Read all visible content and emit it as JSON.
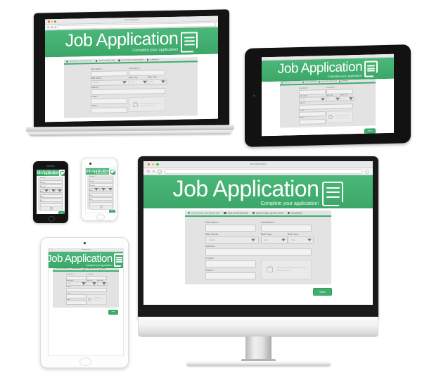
{
  "app": {
    "browser": {
      "window_title": "Job Application",
      "url_placeholder": "",
      "dot_colors": [
        "#ff5f57",
        "#febb2e",
        "#28c840"
      ]
    },
    "header": {
      "title": "Job Application",
      "subtitle": "Complete your application!",
      "icon": "document-form-icon",
      "background_color": "#3fae6e"
    },
    "tabs": [
      {
        "label": "PERSONAL INFORMATION",
        "active": true
      },
      {
        "label": "JOB INFORMATION",
        "active": false
      },
      {
        "label": "ADDITIONAL QUESTIONS",
        "active": false
      },
      {
        "label": "SUMMARY",
        "active": false
      }
    ],
    "form": {
      "fields": [
        {
          "label": "First Name *",
          "value": "",
          "type": "text"
        },
        {
          "label": "Last Name *",
          "value": "",
          "type": "text"
        },
        {
          "label": "Birth Month",
          "value": "",
          "placeholder": "Month",
          "type": "select"
        },
        {
          "label": "Birth Day",
          "value": "",
          "placeholder": "Day",
          "type": "select"
        },
        {
          "label": "Birth Year",
          "value": "",
          "placeholder": "Year",
          "type": "select"
        },
        {
          "label": "Address",
          "value": "",
          "type": "text"
        },
        {
          "label": "E-mail *",
          "value": "",
          "type": "text"
        },
        {
          "label": "Phone *",
          "value": "",
          "type": "text"
        }
      ],
      "privacy_note": "Your personal information is kept safe and secure",
      "privacy_icon": "lock-icon",
      "next_button": "Next"
    },
    "footer_note": ""
  },
  "devices": [
    {
      "name": "laptop",
      "chassis": "black-silver"
    },
    {
      "name": "tablet-landscape",
      "chassis": "black"
    },
    {
      "name": "tablet-portrait",
      "chassis": "white"
    },
    {
      "name": "phone-black",
      "chassis": "black"
    },
    {
      "name": "phone-white",
      "chassis": "white"
    },
    {
      "name": "desktop-monitor",
      "chassis": "black-silver"
    }
  ]
}
